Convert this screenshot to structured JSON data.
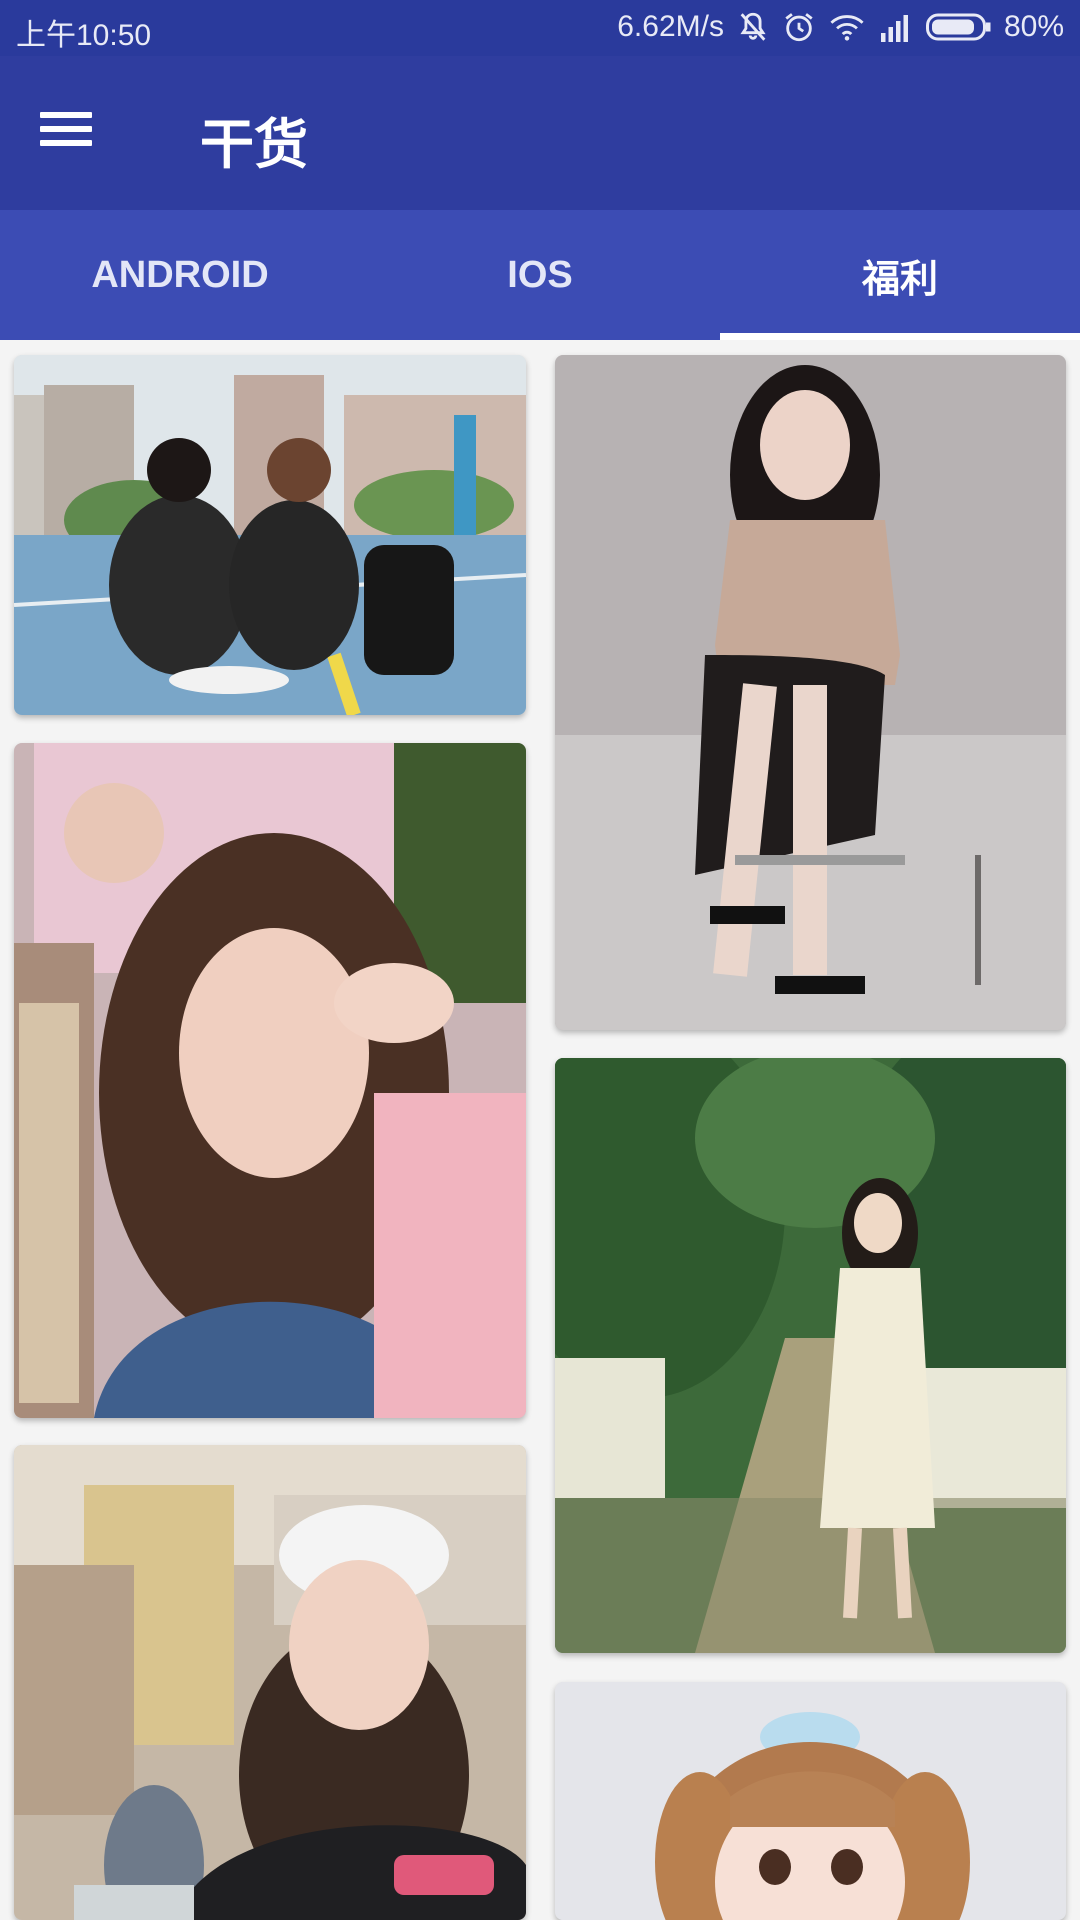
{
  "status_bar": {
    "time": "上午10:50",
    "speed": "6.62M/s",
    "battery": "80%"
  },
  "app_bar": {
    "title": "干货",
    "menu_icon": "hamburger-menu-icon"
  },
  "tabs": [
    {
      "label": "ANDROID",
      "selected": false
    },
    {
      "label": "IOS",
      "selected": false
    },
    {
      "label": "福利",
      "selected": true
    }
  ],
  "colors": {
    "status_bar": "#2a3a9c",
    "app_bar": "#2f3d9f",
    "tab_bar": "#3c4cb4",
    "indicator": "#ffffff"
  },
  "photos": [
    {
      "name": "photo-basketball-court"
    },
    {
      "name": "photo-studio-chair"
    },
    {
      "name": "photo-selfie-peace-sign"
    },
    {
      "name": "photo-tropical-garden"
    },
    {
      "name": "photo-cafe-white-cap"
    },
    {
      "name": "photo-pigtails-portrait"
    }
  ]
}
